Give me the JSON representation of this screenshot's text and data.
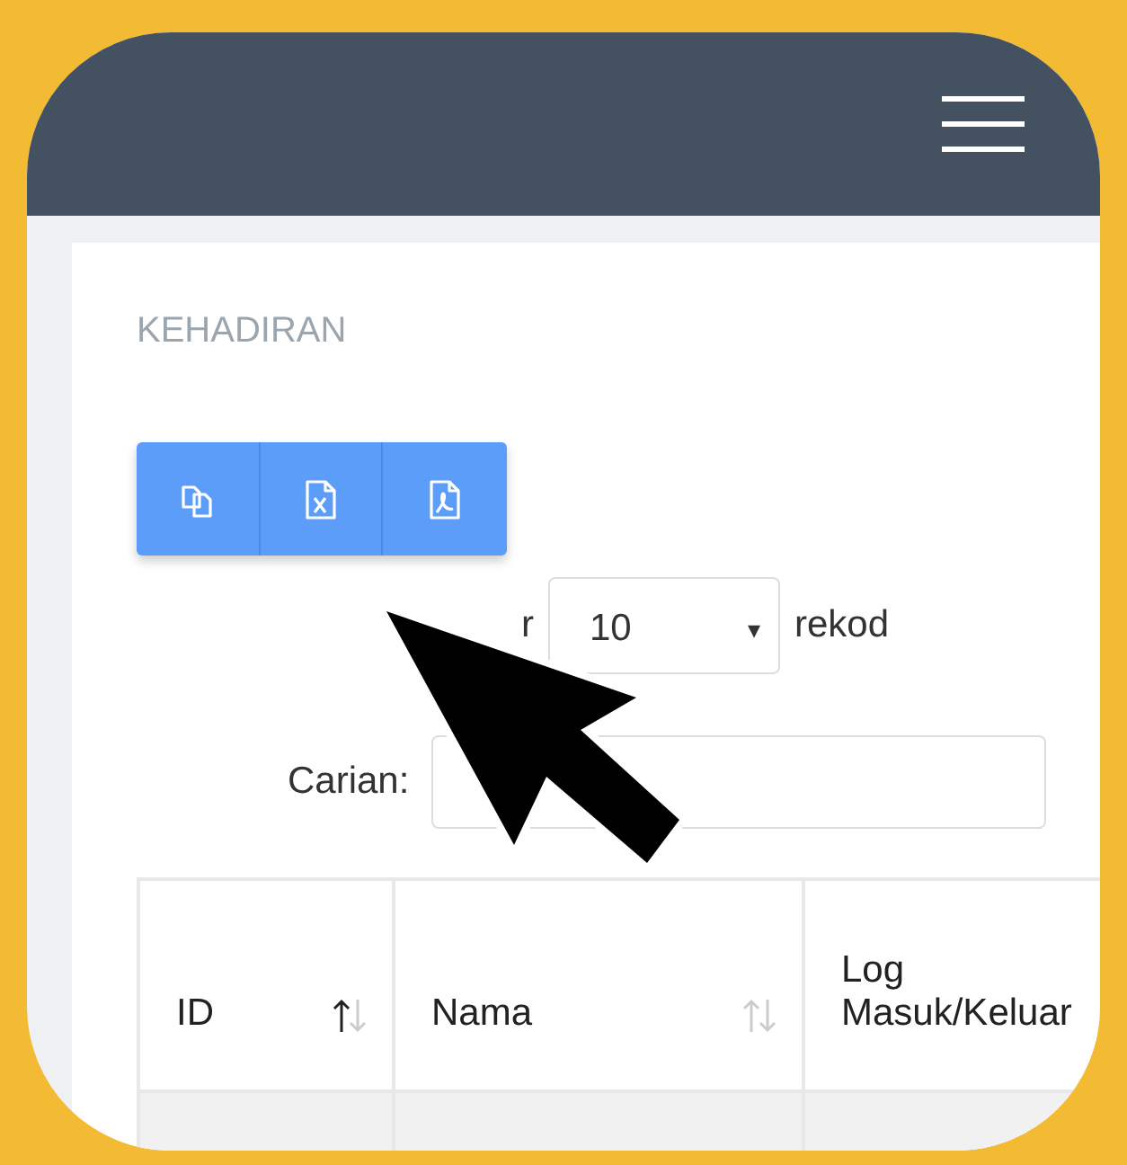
{
  "card": {
    "title": "KEHADIRAN",
    "export_buttons": [
      {
        "kind": "copy"
      },
      {
        "kind": "excel"
      },
      {
        "kind": "pdf"
      }
    ],
    "length": {
      "label": "r",
      "value": "10",
      "caret": "▾",
      "suffix": "rekod"
    },
    "search": {
      "label": "Carian:"
    },
    "table": {
      "columns": [
        {
          "label": "ID",
          "sortable": true,
          "sorted": true
        },
        {
          "label": "Nama",
          "sortable": true,
          "sorted": false
        },
        {
          "label": "Log Masuk/Keluar"
        }
      ]
    }
  },
  "cursor": {
    "kind": "arrow"
  }
}
